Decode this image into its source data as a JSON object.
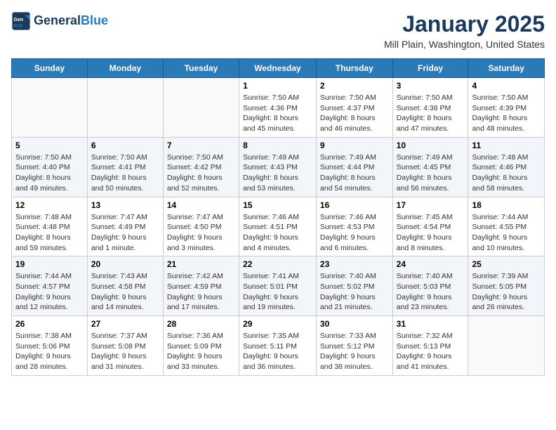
{
  "header": {
    "logo_line1": "General",
    "logo_line2": "Blue",
    "title": "January 2025",
    "subtitle": "Mill Plain, Washington, United States"
  },
  "days_of_week": [
    "Sunday",
    "Monday",
    "Tuesday",
    "Wednesday",
    "Thursday",
    "Friday",
    "Saturday"
  ],
  "weeks": [
    [
      {
        "day": "",
        "info": ""
      },
      {
        "day": "",
        "info": ""
      },
      {
        "day": "",
        "info": ""
      },
      {
        "day": "1",
        "info": "Sunrise: 7:50 AM\nSunset: 4:36 PM\nDaylight: 8 hours and 45 minutes."
      },
      {
        "day": "2",
        "info": "Sunrise: 7:50 AM\nSunset: 4:37 PM\nDaylight: 8 hours and 46 minutes."
      },
      {
        "day": "3",
        "info": "Sunrise: 7:50 AM\nSunset: 4:38 PM\nDaylight: 8 hours and 47 minutes."
      },
      {
        "day": "4",
        "info": "Sunrise: 7:50 AM\nSunset: 4:39 PM\nDaylight: 8 hours and 48 minutes."
      }
    ],
    [
      {
        "day": "5",
        "info": "Sunrise: 7:50 AM\nSunset: 4:40 PM\nDaylight: 8 hours and 49 minutes."
      },
      {
        "day": "6",
        "info": "Sunrise: 7:50 AM\nSunset: 4:41 PM\nDaylight: 8 hours and 50 minutes."
      },
      {
        "day": "7",
        "info": "Sunrise: 7:50 AM\nSunset: 4:42 PM\nDaylight: 8 hours and 52 minutes."
      },
      {
        "day": "8",
        "info": "Sunrise: 7:49 AM\nSunset: 4:43 PM\nDaylight: 8 hours and 53 minutes."
      },
      {
        "day": "9",
        "info": "Sunrise: 7:49 AM\nSunset: 4:44 PM\nDaylight: 8 hours and 54 minutes."
      },
      {
        "day": "10",
        "info": "Sunrise: 7:49 AM\nSunset: 4:45 PM\nDaylight: 8 hours and 56 minutes."
      },
      {
        "day": "11",
        "info": "Sunrise: 7:48 AM\nSunset: 4:46 PM\nDaylight: 8 hours and 58 minutes."
      }
    ],
    [
      {
        "day": "12",
        "info": "Sunrise: 7:48 AM\nSunset: 4:48 PM\nDaylight: 8 hours and 59 minutes."
      },
      {
        "day": "13",
        "info": "Sunrise: 7:47 AM\nSunset: 4:49 PM\nDaylight: 9 hours and 1 minute."
      },
      {
        "day": "14",
        "info": "Sunrise: 7:47 AM\nSunset: 4:50 PM\nDaylight: 9 hours and 3 minutes."
      },
      {
        "day": "15",
        "info": "Sunrise: 7:46 AM\nSunset: 4:51 PM\nDaylight: 9 hours and 4 minutes."
      },
      {
        "day": "16",
        "info": "Sunrise: 7:46 AM\nSunset: 4:53 PM\nDaylight: 9 hours and 6 minutes."
      },
      {
        "day": "17",
        "info": "Sunrise: 7:45 AM\nSunset: 4:54 PM\nDaylight: 9 hours and 8 minutes."
      },
      {
        "day": "18",
        "info": "Sunrise: 7:44 AM\nSunset: 4:55 PM\nDaylight: 9 hours and 10 minutes."
      }
    ],
    [
      {
        "day": "19",
        "info": "Sunrise: 7:44 AM\nSunset: 4:57 PM\nDaylight: 9 hours and 12 minutes."
      },
      {
        "day": "20",
        "info": "Sunrise: 7:43 AM\nSunset: 4:58 PM\nDaylight: 9 hours and 14 minutes."
      },
      {
        "day": "21",
        "info": "Sunrise: 7:42 AM\nSunset: 4:59 PM\nDaylight: 9 hours and 17 minutes."
      },
      {
        "day": "22",
        "info": "Sunrise: 7:41 AM\nSunset: 5:01 PM\nDaylight: 9 hours and 19 minutes."
      },
      {
        "day": "23",
        "info": "Sunrise: 7:40 AM\nSunset: 5:02 PM\nDaylight: 9 hours and 21 minutes."
      },
      {
        "day": "24",
        "info": "Sunrise: 7:40 AM\nSunset: 5:03 PM\nDaylight: 9 hours and 23 minutes."
      },
      {
        "day": "25",
        "info": "Sunrise: 7:39 AM\nSunset: 5:05 PM\nDaylight: 9 hours and 26 minutes."
      }
    ],
    [
      {
        "day": "26",
        "info": "Sunrise: 7:38 AM\nSunset: 5:06 PM\nDaylight: 9 hours and 28 minutes."
      },
      {
        "day": "27",
        "info": "Sunrise: 7:37 AM\nSunset: 5:08 PM\nDaylight: 9 hours and 31 minutes."
      },
      {
        "day": "28",
        "info": "Sunrise: 7:36 AM\nSunset: 5:09 PM\nDaylight: 9 hours and 33 minutes."
      },
      {
        "day": "29",
        "info": "Sunrise: 7:35 AM\nSunset: 5:11 PM\nDaylight: 9 hours and 36 minutes."
      },
      {
        "day": "30",
        "info": "Sunrise: 7:33 AM\nSunset: 5:12 PM\nDaylight: 9 hours and 38 minutes."
      },
      {
        "day": "31",
        "info": "Sunrise: 7:32 AM\nSunset: 5:13 PM\nDaylight: 9 hours and 41 minutes."
      },
      {
        "day": "",
        "info": ""
      }
    ]
  ]
}
